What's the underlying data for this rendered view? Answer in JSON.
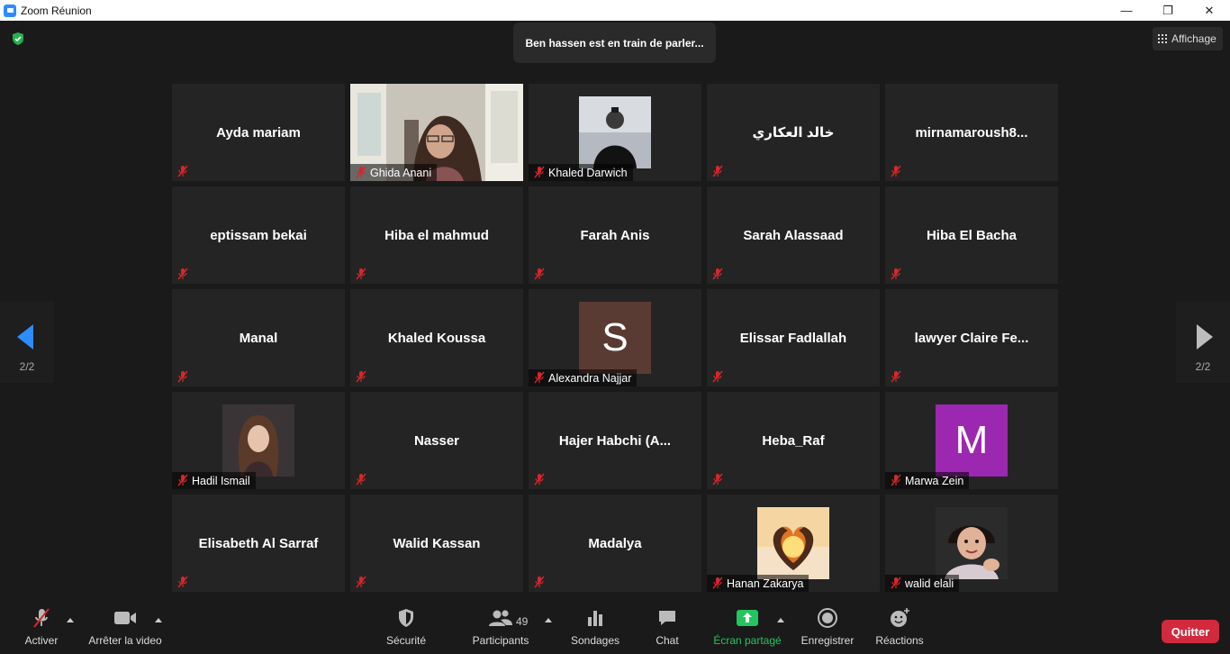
{
  "window": {
    "title": "Zoom Réunion",
    "controls": [
      "—",
      "❐",
      "✕"
    ]
  },
  "banner": {
    "speaking": "Ben hassen est en train de parler..."
  },
  "view": {
    "label": "Affichage"
  },
  "nav": {
    "left_page": "2/2",
    "right_page": "2/2"
  },
  "participants": [
    {
      "name": "Ayda mariam",
      "kind": "name"
    },
    {
      "name": "Ghida Anani",
      "kind": "video"
    },
    {
      "name": "Khaled Darwich",
      "kind": "photo",
      "photo": "man"
    },
    {
      "name": "خالد العكاري",
      "kind": "name"
    },
    {
      "name": "mirnamaroush8...",
      "kind": "name"
    },
    {
      "name": "eptissam bekai",
      "kind": "name"
    },
    {
      "name": "Hiba el mahmud",
      "kind": "name"
    },
    {
      "name": "Farah Anis",
      "kind": "name"
    },
    {
      "name": "Sarah Alassaad",
      "kind": "name"
    },
    {
      "name": "Hiba El Bacha",
      "kind": "name"
    },
    {
      "name": "Manal",
      "kind": "name"
    },
    {
      "name": "Khaled Koussa",
      "kind": "name"
    },
    {
      "name": "Alexandra Najjar",
      "kind": "letter",
      "letter": "S",
      "color": "#5a3b33"
    },
    {
      "name": "Elissar Fadlallah",
      "kind": "name"
    },
    {
      "name": "lawyer  Claire  Fe...",
      "kind": "name"
    },
    {
      "name": "Hadil Ismail",
      "kind": "photo",
      "photo": "woman"
    },
    {
      "name": "Nasser",
      "kind": "name"
    },
    {
      "name": "Hajer  Habchi  (A...",
      "kind": "name"
    },
    {
      "name": "Heba_Raf",
      "kind": "name"
    },
    {
      "name": "Marwa Zein",
      "kind": "letter",
      "letter": "M",
      "color": "#9c27b0"
    },
    {
      "name": "Elisabeth Al Sarraf",
      "kind": "name"
    },
    {
      "name": "Walid Kassan",
      "kind": "name"
    },
    {
      "name": "Madalya",
      "kind": "name"
    },
    {
      "name": "Hanan Zakarya",
      "kind": "photo",
      "photo": "heart"
    },
    {
      "name": "walid elali",
      "kind": "photo",
      "photo": "child"
    }
  ],
  "toolbar": {
    "unmute": "Activer",
    "stop_video": "Arrêter la video",
    "security": "Sécurité",
    "participants": "Participants",
    "participants_count": "49",
    "polls": "Sondages",
    "chat": "Chat",
    "share": "Écran partagé",
    "record": "Enregistrer",
    "reactions": "Réactions",
    "leave": "Quitter"
  },
  "colors": {
    "accent": "#2d8cff",
    "share": "#22c55e",
    "leave": "#d1293d",
    "muted": "#d9262a"
  }
}
